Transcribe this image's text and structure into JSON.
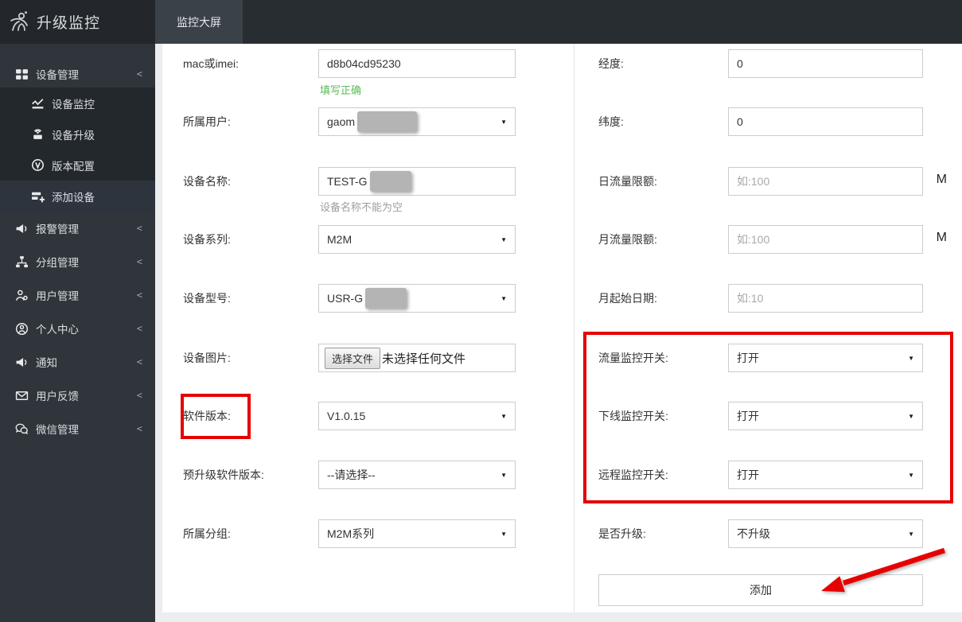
{
  "app": {
    "brand": "升级监控",
    "topbar_tab": "监控大屏"
  },
  "sidebar": {
    "device_mgmt": {
      "label": "设备管理",
      "chevron": "<"
    },
    "sub": [
      {
        "label": "设备监控"
      },
      {
        "label": "设备升级"
      },
      {
        "label": "版本配置"
      },
      {
        "label": "添加设备"
      }
    ],
    "items": [
      {
        "label": "报警管理",
        "chevron": "<"
      },
      {
        "label": "分组管理",
        "chevron": "<"
      },
      {
        "label": "用户管理",
        "chevron": "<"
      },
      {
        "label": "个人中心",
        "chevron": "<"
      },
      {
        "label": "通知",
        "chevron": "<"
      },
      {
        "label": "用户反馈",
        "chevron": "<"
      },
      {
        "label": "微信管理",
        "chevron": "<"
      }
    ]
  },
  "form": {
    "left": [
      {
        "label": "mac或imei:",
        "value": "d8b04cd95230",
        "helper": "填写正确"
      },
      {
        "label": "所属用户:",
        "value": "gaom"
      },
      {
        "label": "设备名称:",
        "value": "TEST-G",
        "helper": "设备名称不能为空"
      },
      {
        "label": "设备系列:",
        "value": "M2M"
      },
      {
        "label": "设备型号:",
        "value": "USR-G"
      },
      {
        "label": "设备图片:",
        "button": "选择文件",
        "file_text": "未选择任何文件"
      },
      {
        "label": "软件版本:",
        "value": "V1.0.15"
      },
      {
        "label": "预升级软件版本:",
        "value": "--请选择--"
      },
      {
        "label": "所属分组:",
        "value": "M2M系列"
      }
    ],
    "right": [
      {
        "label": "经度:",
        "value": "0"
      },
      {
        "label": "纬度:",
        "value": "0"
      },
      {
        "label": "日流量限额:",
        "placeholder": "如:100",
        "suffix": "M"
      },
      {
        "label": "月流量限额:",
        "placeholder": "如:100",
        "suffix": "M"
      },
      {
        "label": "月起始日期:",
        "placeholder": "如:10"
      },
      {
        "label": "流量监控开关:",
        "value": "打开"
      },
      {
        "label": "下线监控开关:",
        "value": "打开"
      },
      {
        "label": "远程监控开关:",
        "value": "打开"
      },
      {
        "label": "是否升级:",
        "value": "不升级"
      }
    ],
    "submit": "添加"
  },
  "colors": {
    "annotation_red": "#e60000",
    "success_green": "#5cb85c",
    "sidebar_bg": "#2f353b",
    "topbar_bg": "#282d31"
  }
}
